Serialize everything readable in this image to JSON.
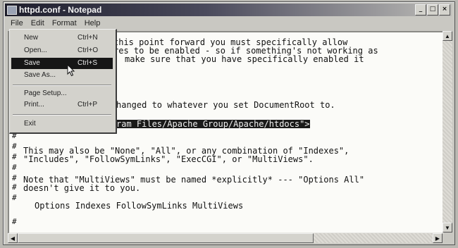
{
  "window": {
    "title": "httpd.conf - Notepad",
    "controls": [
      "_",
      "□",
      "×"
    ]
  },
  "menubar": [
    "File",
    "Edit",
    "Format",
    "Help"
  ],
  "file_menu": {
    "items": [
      {
        "label": "New",
        "shortcut": "Ctrl+N"
      },
      {
        "label": "Open...",
        "shortcut": "Ctrl+O"
      },
      {
        "label": "Save",
        "shortcut": "Ctrl+S",
        "state": "highlighted"
      },
      {
        "label": "Save As...",
        "shortcut": ""
      },
      {
        "label": "Page Setup...",
        "shortcut": ""
      },
      {
        "label": "Print...",
        "shortcut": "Ctrl+P"
      },
      {
        "label": "Exit",
        "shortcut": ""
      }
    ]
  },
  "editor": {
    "lines": [
      "this point forward you must specifically allow",
      "res to be enabled - so if something's not working as",
      "make sure that you have specifically enabled it",
      "hanged to whatever you set DocumentRoot to.",
      "ram Files/Apache Group/Apache/htdocs\">",
      "This may also be \"None\", \"All\", or any combination of \"Indexes\",",
      "\"Includes\", \"FollowSymLinks\", \"ExecCGI\", or \"MultiViews\".",
      "Note that \"MultiViews\" must be named *explicitly* --- \"Options All\"",
      "doesn't give it to you.",
      "Options Indexes FollowSymLinks MultiViews"
    ],
    "selected_line_index": 4,
    "comment_char": "#"
  }
}
